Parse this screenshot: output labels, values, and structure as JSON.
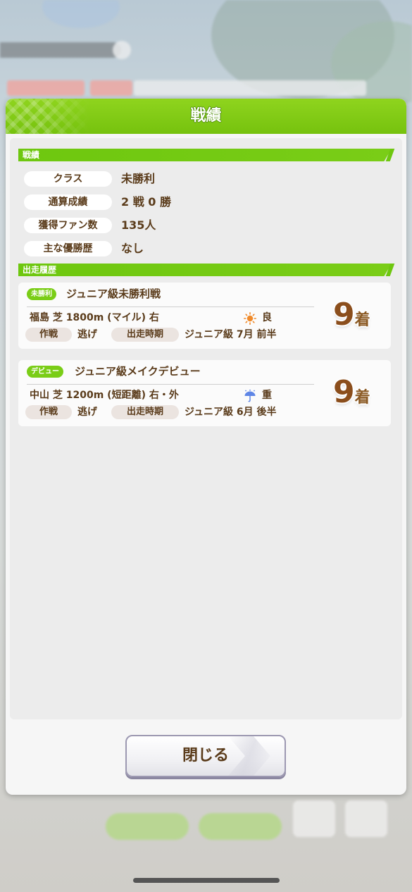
{
  "dialog": {
    "title": "戦績",
    "close_label": "閉じる"
  },
  "record": {
    "section_title": "戦績",
    "rows": [
      {
        "label": "クラス",
        "value": "未勝利"
      },
      {
        "label": "通算成績",
        "value": "2 戦 0 勝"
      },
      {
        "label": "獲得ファン数",
        "value": "135人"
      },
      {
        "label": "主な優勝歴",
        "value": "なし"
      }
    ]
  },
  "history": {
    "section_title": "出走履歴",
    "races": [
      {
        "badge": "未勝利",
        "name": "ジュニア級未勝利戦",
        "course": "福島 芝 1800m (マイル) 右",
        "weather_icon": "sun-icon",
        "condition": "良",
        "strategy_label": "作戦",
        "strategy": "逃げ",
        "period_label": "出走時期",
        "period": "ジュニア級 7月 前半",
        "placement_num": "9",
        "placement_suffix": "着"
      },
      {
        "badge": "デビュー",
        "name": "ジュニア級メイクデビュー",
        "course": "中山 芝 1200m (短距離) 右・外",
        "weather_icon": "rain-umbrella-icon",
        "condition": "重",
        "strategy_label": "作戦",
        "strategy": "逃げ",
        "period_label": "出走時期",
        "period": "ジュニア級 6月 後半",
        "placement_num": "9",
        "placement_suffix": "着"
      }
    ]
  },
  "colors": {
    "accent_green": "#76c20e",
    "text_brown": "#5a3b1a",
    "placement_brown": "#8b4e1c"
  }
}
